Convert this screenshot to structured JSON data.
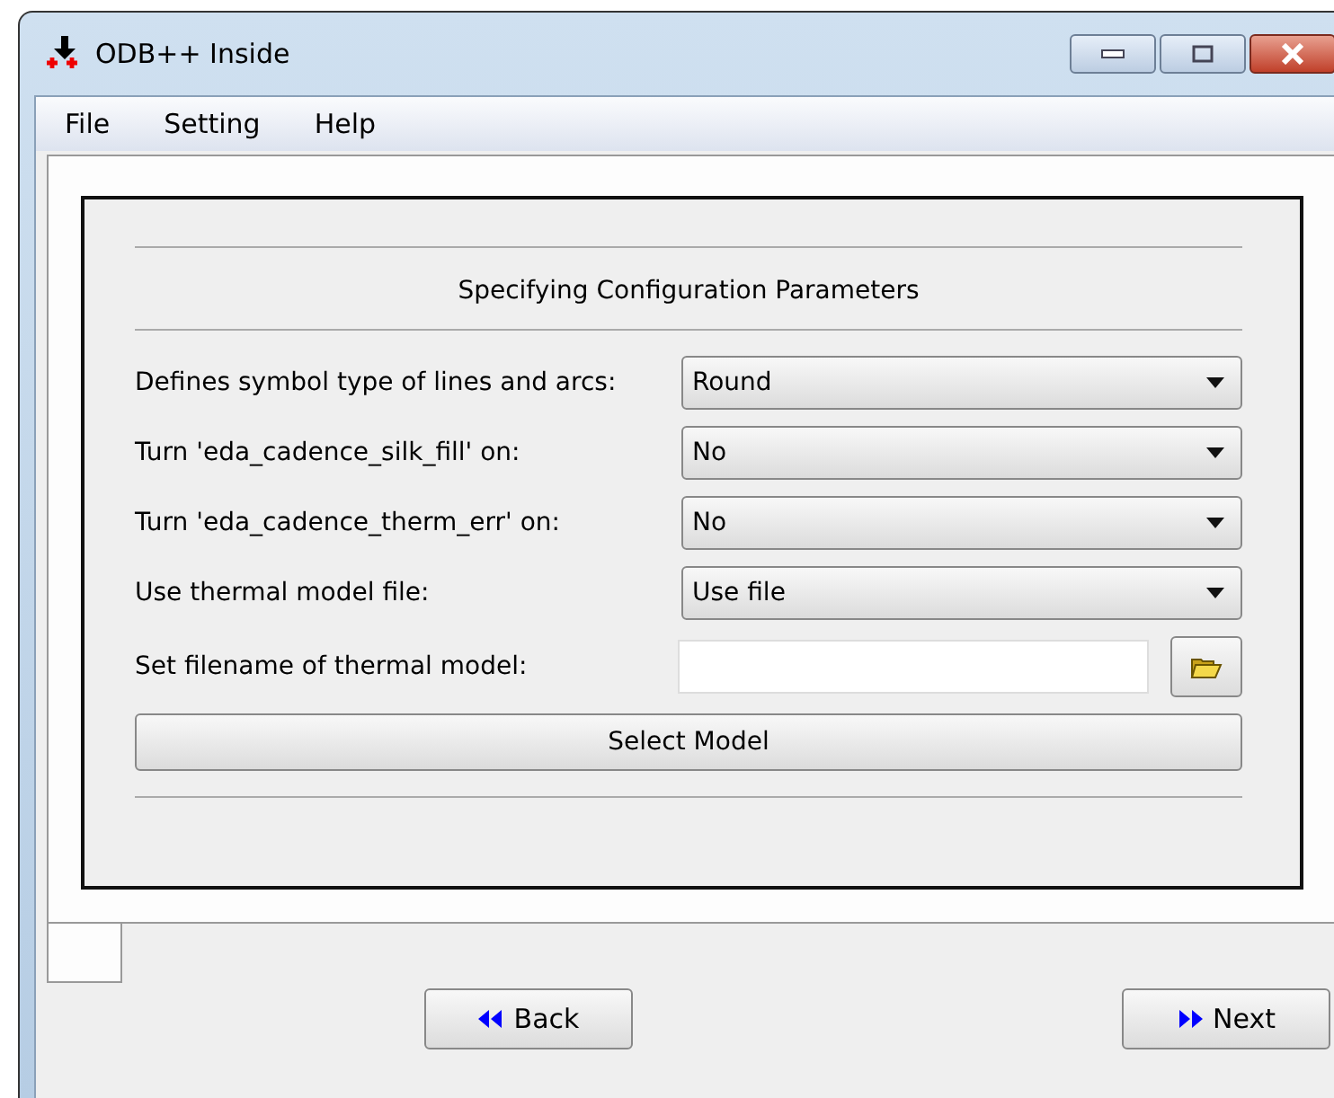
{
  "window": {
    "title": "ODB++ Inside"
  },
  "menu": [
    "File",
    "Setting",
    "Help"
  ],
  "section_title": "Specifying Configuration Parameters",
  "fields": [
    {
      "kind": "dropdown",
      "label": "Defines symbol type of lines and arcs:",
      "value": "Round"
    },
    {
      "kind": "dropdown",
      "label": "Turn 'eda_cadence_silk_fill' on:",
      "value": "No"
    },
    {
      "kind": "dropdown",
      "label": "Turn 'eda_cadence_therm_err' on:",
      "value": "No"
    },
    {
      "kind": "dropdown",
      "label": "Use thermal model file:",
      "value": "Use file"
    },
    {
      "kind": "file",
      "label": "Set filename of thermal model:"
    }
  ],
  "action_button": "Select Model",
  "nav_buttons": [
    {
      "kind": "back",
      "label": "Back"
    },
    {
      "kind": "next",
      "label": "Next"
    }
  ]
}
